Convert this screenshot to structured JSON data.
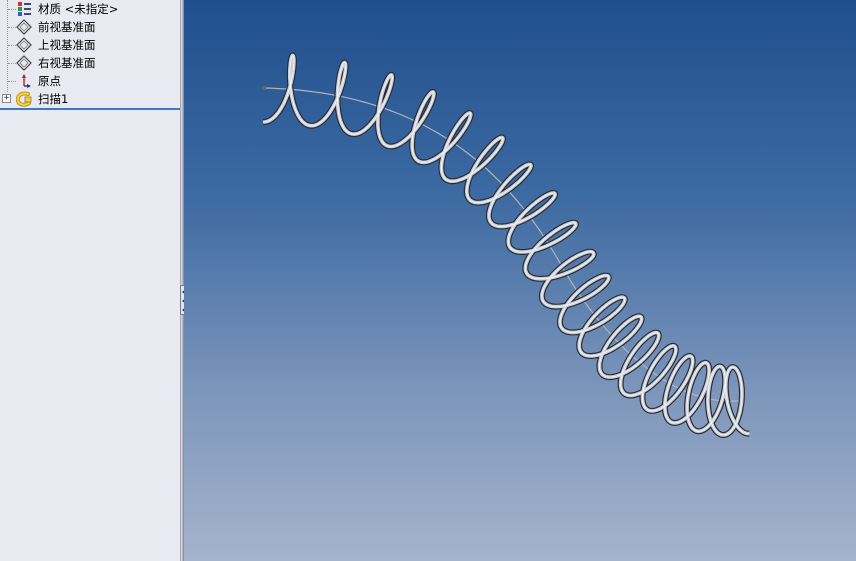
{
  "feature_tree": {
    "items": [
      {
        "label": "材质 <未指定>",
        "icon": "material-icon"
      },
      {
        "label": "前视基准面",
        "icon": "plane-icon"
      },
      {
        "label": "上视基准面",
        "icon": "plane-icon"
      },
      {
        "label": "右视基准面",
        "icon": "plane-icon"
      },
      {
        "label": "原点",
        "icon": "origin-icon"
      },
      {
        "label": "扫描1",
        "icon": "sweep-icon"
      }
    ],
    "expander": "+"
  },
  "viewport": {
    "model": "swept-coil-spring",
    "background_top": "#1f4f8d",
    "background_bottom": "#a5b3cc",
    "coil_color": "#c8ccd4",
    "path_color": "#b0b4bc"
  }
}
